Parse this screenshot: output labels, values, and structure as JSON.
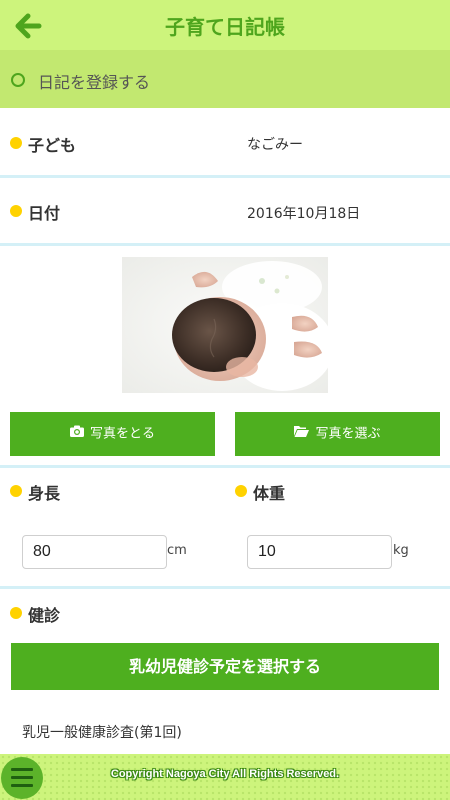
{
  "header": {
    "title": "子育て日記帳",
    "back_icon": "arrow-left-icon"
  },
  "subheader": {
    "title": "日記を登録する"
  },
  "child": {
    "label": "子ども",
    "value": "なごみー"
  },
  "date": {
    "label": "日付",
    "value": "2016年10月18日"
  },
  "photo": {
    "alt": ""
  },
  "photo_buttons": {
    "take": {
      "label": "写真をとる",
      "icon": "camera-icon"
    },
    "choose": {
      "label": "写真を選ぶ",
      "icon": "folder-open-icon"
    }
  },
  "height": {
    "label": "身長",
    "value": "80",
    "unit": "cm"
  },
  "weight": {
    "label": "体重",
    "value": "10",
    "unit": "kg"
  },
  "checkup": {
    "label": "健診",
    "select_button": "乳幼児健診予定を選択する",
    "selected": "乳児一般健康診査(第1回)"
  },
  "footer": {
    "copyright": "Copyright Nagoya City All Rights Reserved.",
    "menu_icon": "hamburger-menu-icon"
  },
  "colors": {
    "accent": "#4eaf1f",
    "header_bg": "#cdf47c",
    "bullet": "#ffd200",
    "divider": "#d4f0f7"
  }
}
